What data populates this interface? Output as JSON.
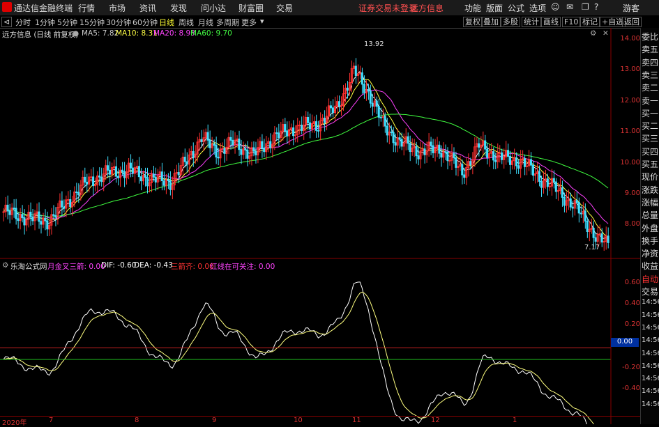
{
  "menubar": {
    "app_title": "通达信金融终端",
    "menus": [
      "行情",
      "市场",
      "资讯",
      "发现",
      "问小达",
      "财富圈",
      "交易"
    ],
    "notice": "证券交易未登录",
    "stock_name": "远方信息",
    "right_menus": [
      "功能",
      "版面",
      "公式",
      "选项"
    ],
    "guest": "游客"
  },
  "subbar": {
    "periods": [
      "分时",
      "1分钟",
      "5分钟",
      "15分钟",
      "30分钟",
      "60分钟",
      "日线",
      "周线",
      "月线",
      "多周期",
      "更多"
    ],
    "active_period": "日线",
    "tools": [
      "复权",
      "叠加",
      "多股",
      "统计",
      "画线",
      "F10",
      "标记",
      "+自选",
      "返回"
    ]
  },
  "main_chart": {
    "title": "远方信息 (日线 前复权)",
    "ma_labels": [
      {
        "text": "MA5: 7.82",
        "color": "#ffffff"
      },
      {
        "text": "MA10: 8.31",
        "color": "#ffff40"
      },
      {
        "text": "MA20: 8.93",
        "color": "#ff40ff"
      },
      {
        "text": "MA60: 9.70",
        "color": "#40ff40"
      }
    ],
    "high_label": "13.92",
    "low_label": "7.17",
    "y_ticks": [
      "14.00",
      "13.00",
      "12.00",
      "11.00",
      "10.00",
      "9.00",
      "8.00"
    ]
  },
  "indicator": {
    "name": "乐淘公式网",
    "labels": [
      {
        "text": "月金叉三箭: 0.00",
        "color": "#ff40ff"
      },
      {
        "text": "DIF: -0.60",
        "color": "#ffffff"
      },
      {
        "text": "DEA: -0.43",
        "color": "#ffffff"
      },
      {
        "text": "三箭齐: 0.00",
        "color": "#ff3030"
      },
      {
        "text": "红线在可关注: 0.00",
        "color": "#ff40ff"
      }
    ],
    "y_ticks": [
      "0.60",
      "0.40",
      "0.20",
      "-0.20",
      "-0.40"
    ],
    "zero_label": "0.00"
  },
  "x_axis": [
    "2020年",
    "7",
    "8",
    "9",
    "10",
    "11",
    "12",
    "1"
  ],
  "right_panel": {
    "items": [
      "委比",
      "卖五",
      "卖四",
      "卖三",
      "卖二",
      "卖一",
      "买一",
      "买二",
      "买三",
      "买四",
      "买五",
      "现价",
      "涨跌",
      "涨幅",
      "总量",
      "外盘",
      "换手",
      "净资",
      "收益",
      "自动",
      "交易",
      "14:56",
      "14:56",
      "14:56",
      "14:56",
      "14:56",
      "14:56",
      "14:56",
      "14:56",
      "14:56"
    ]
  },
  "chart_data": {
    "type": "candlestick",
    "price_range": [
      7.0,
      14.2
    ],
    "macd_range": [
      -0.5,
      0.75
    ],
    "highest": 13.92,
    "lowest": 7.17,
    "ma_last": {
      "MA5": 7.82,
      "MA10": 8.31,
      "MA20": 8.93,
      "MA60": 9.7
    },
    "dif_last": -0.6,
    "dea_last": -0.43
  },
  "colors": {
    "up": "#ff3030",
    "down": "#40e0ff",
    "ma5": "#ffffff",
    "ma10": "#ffff40",
    "ma20": "#ff40ff",
    "ma60": "#40ff40"
  }
}
